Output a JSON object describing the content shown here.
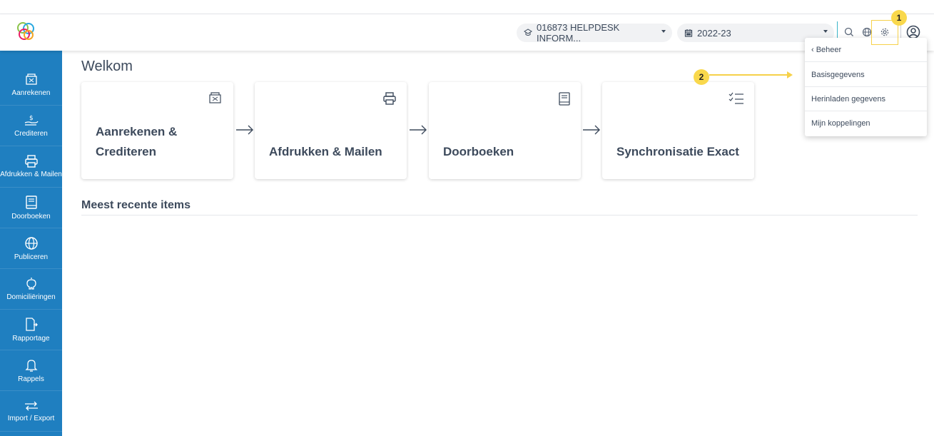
{
  "header": {
    "school_selector": "016873 HELPDESK INFORM...",
    "year_selector": "2022-23"
  },
  "sidebar": {
    "items": [
      {
        "label": "Aanrekenen",
        "icon": "invoice-icon"
      },
      {
        "label": "Crediteren",
        "icon": "hand-money-icon"
      },
      {
        "label": "Afdrukken & Mailen",
        "icon": "printer-icon"
      },
      {
        "label": "Doorboeken",
        "icon": "book-icon"
      },
      {
        "label": "Publiceren",
        "icon": "globe-icon"
      },
      {
        "label": "Domiciliëringen",
        "icon": "piggy-bank-icon"
      },
      {
        "label": "Rapportage",
        "icon": "report-icon"
      },
      {
        "label": "Rappels",
        "icon": "bell-icon"
      },
      {
        "label": "Import / Export",
        "icon": "import-export-icon"
      }
    ]
  },
  "main": {
    "title": "Welkom",
    "cards": [
      {
        "title": "Aanrekenen & Crediteren",
        "icon": "invoice-icon"
      },
      {
        "title": "Afdrukken & Mailen",
        "icon": "printer-icon"
      },
      {
        "title": "Doorboeken",
        "icon": "book-icon"
      },
      {
        "title": "Synchronisatie Exact",
        "icon": "checklist-icon"
      }
    ],
    "recent_title": "Meest recente items"
  },
  "dropdown": {
    "back": "‹ Beheer",
    "items": [
      "Basisgegevens",
      "Herinladen gegevens",
      "Mijn koppelingen"
    ]
  },
  "annotations": {
    "badge_1": "1",
    "badge_2": "2",
    "color": "#f6d14a"
  },
  "colors": {
    "sidebar": "#1f7fc0",
    "accent": "#3ab5c9",
    "text": "#3d4a5c"
  }
}
